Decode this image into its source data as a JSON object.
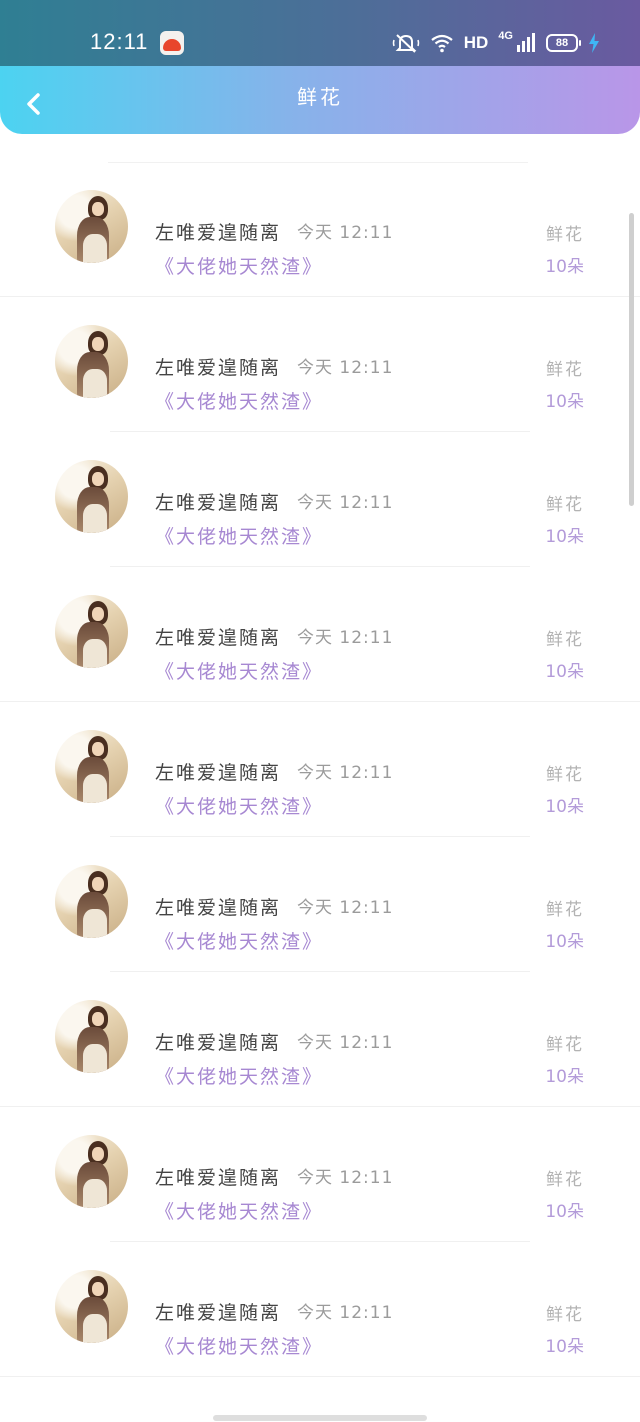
{
  "status_bar": {
    "time": "12:11",
    "app_icon": "game-app-icon",
    "icons": [
      "mute-icon",
      "wifi-icon",
      "signal-icon",
      "charging-icon"
    ],
    "hd": "HD",
    "network": "4G",
    "battery": "88"
  },
  "header": {
    "title": "鲜花",
    "back_icon": "chevron-left-icon",
    "gradient_colors": [
      "#4cd3f1",
      "#86b3ea",
      "#b996e8"
    ]
  },
  "records": [
    {
      "name": "左唯爱遑随离",
      "time": "今天 12:11",
      "book": "《大佬她天然渣》",
      "gift": "鲜花",
      "count": "10朵"
    },
    {
      "name": "左唯爱遑随离",
      "time": "今天 12:11",
      "book": "《大佬她天然渣》",
      "gift": "鲜花",
      "count": "10朵"
    },
    {
      "name": "左唯爱遑随离",
      "time": "今天 12:11",
      "book": "《大佬她天然渣》",
      "gift": "鲜花",
      "count": "10朵"
    },
    {
      "name": "左唯爱遑随离",
      "time": "今天 12:11",
      "book": "《大佬她天然渣》",
      "gift": "鲜花",
      "count": "10朵"
    },
    {
      "name": "左唯爱遑随离",
      "time": "今天 12:11",
      "book": "《大佬她天然渣》",
      "gift": "鲜花",
      "count": "10朵"
    },
    {
      "name": "左唯爱遑随离",
      "time": "今天 12:11",
      "book": "《大佬她天然渣》",
      "gift": "鲜花",
      "count": "10朵"
    },
    {
      "name": "左唯爱遑随离",
      "time": "今天 12:11",
      "book": "《大佬她天然渣》",
      "gift": "鲜花",
      "count": "10朵"
    },
    {
      "name": "左唯爱遑随离",
      "time": "今天 12:11",
      "book": "《大佬她天然渣》",
      "gift": "鲜花",
      "count": "10朵"
    },
    {
      "name": "左唯爱遑随离",
      "time": "今天 12:11",
      "book": "《大佬她天然渣》",
      "gift": "鲜花",
      "count": "10朵"
    }
  ]
}
